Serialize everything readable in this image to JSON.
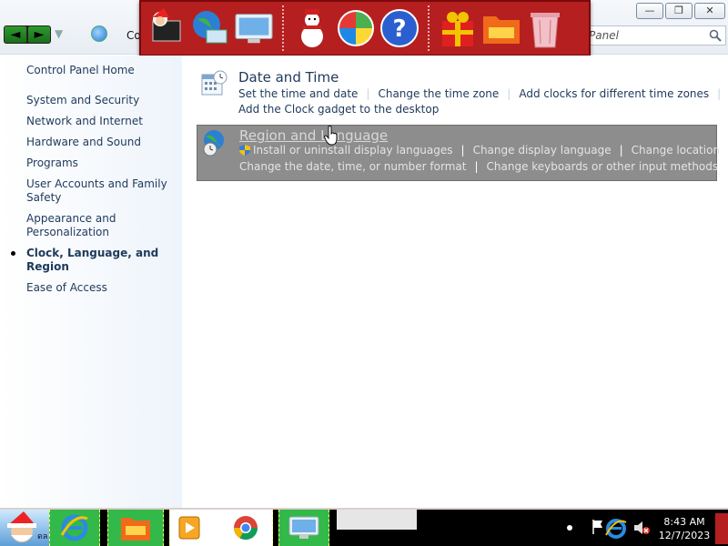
{
  "window": {
    "breadcrumb_partial": "Co",
    "search_text": "Panel",
    "controls": {
      "minimize": "—",
      "maximize": "❐",
      "close": "✕"
    }
  },
  "nav": {
    "back": "◄",
    "forward": "►",
    "dropdown": "▼"
  },
  "dock": {
    "icons": [
      "santa-computer-icon",
      "globe-network-icon",
      "monitor-display-icon",
      "snowman-icon",
      "windows-shield-icon",
      "help-icon",
      "gift-icon",
      "folder-icon",
      "recycle-bin-icon"
    ]
  },
  "sidebar": {
    "home": "Control Panel Home",
    "items": [
      {
        "label": "System and Security"
      },
      {
        "label": "Network and Internet"
      },
      {
        "label": "Hardware and Sound"
      },
      {
        "label": "Programs"
      },
      {
        "label": "User Accounts and Family Safety"
      },
      {
        "label": "Appearance and Personalization"
      },
      {
        "label": "Clock, Language, and Region",
        "active": true
      },
      {
        "label": "Ease of Access"
      }
    ]
  },
  "categories": {
    "date_time": {
      "title": "Date and Time",
      "links": [
        "Set the time and date",
        "Change the time zone",
        "Add clocks for different time zones",
        "Add the Clock gadget to the desktop"
      ]
    },
    "region_language": {
      "title": "Region and Language",
      "links": [
        "Install or uninstall display languages",
        "Change display language",
        "Change location",
        "Change the date, time, or number format",
        "Change keyboards or other input methods"
      ]
    }
  },
  "taskbar": {
    "start_text": "ดล",
    "apps": [
      "internet-explorer-icon",
      "folder-icon",
      "media-player-icon",
      "chrome-icon",
      "display-settings-icon"
    ]
  },
  "tray": {
    "time": "8:43 AM",
    "date": "12/7/2023"
  },
  "colors": {
    "dock_red": "#b51f1f",
    "link_blue": "#1e395b",
    "selection_gray": "#8d8d8d",
    "taskbar_green": "#33b84a"
  }
}
